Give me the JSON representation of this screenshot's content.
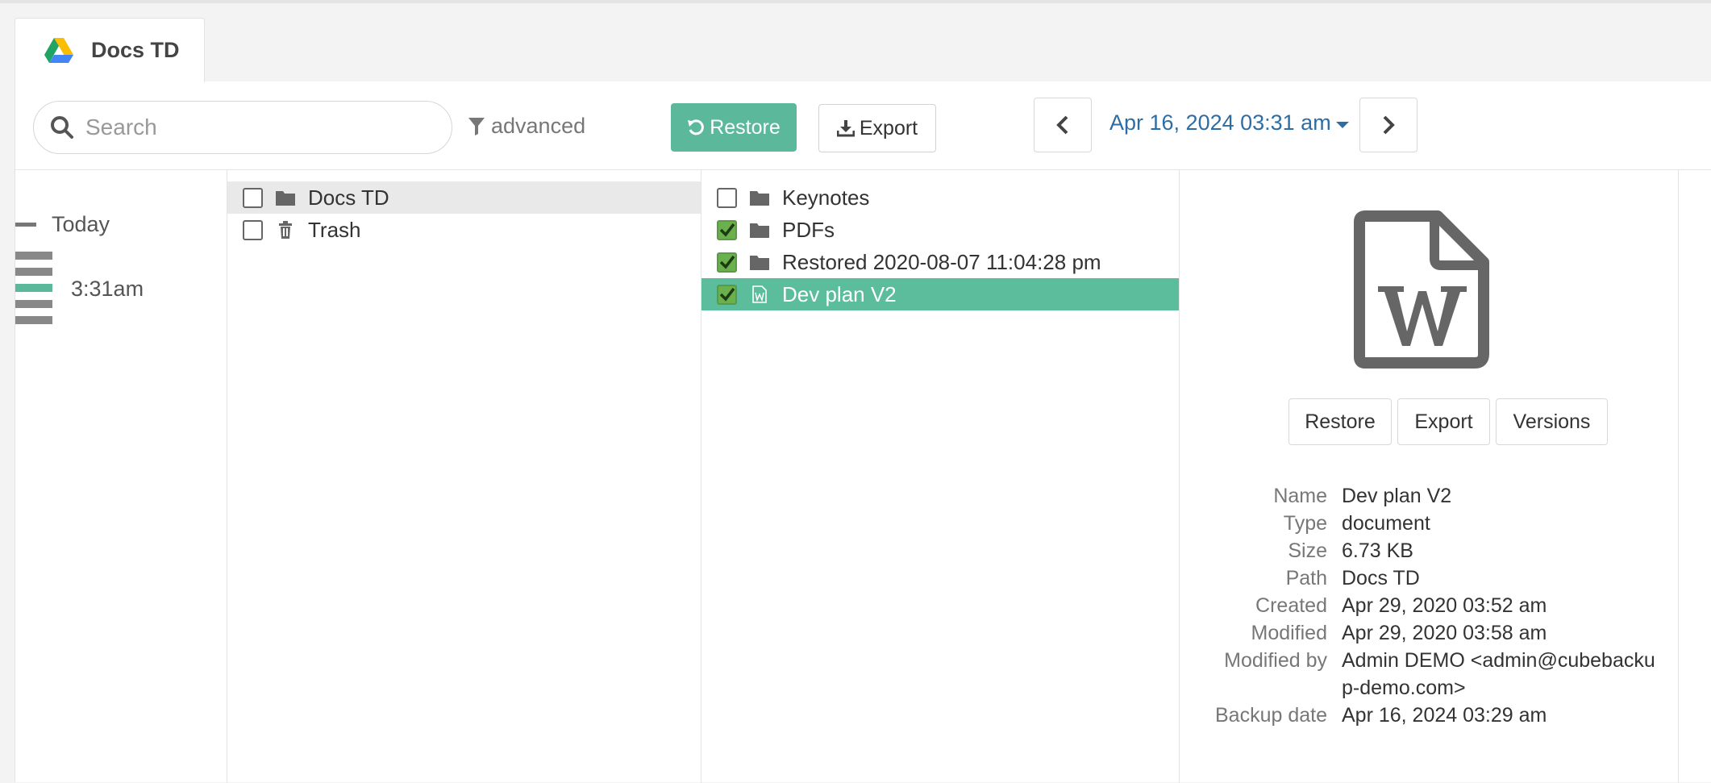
{
  "tab": {
    "label": "Docs TD",
    "logo_icon": "google-drive-icon"
  },
  "toolbar": {
    "search_placeholder": "Search",
    "advanced_label": "advanced",
    "restore_label": "Restore",
    "export_label": "Export",
    "date_label": "Apr 16, 2024 03:31 am"
  },
  "timeline": {
    "today_label": "Today",
    "time_label": "3:31am"
  },
  "tree": {
    "items": [
      {
        "label": "Docs TD",
        "icon": "folder-icon",
        "checked": false,
        "selected": true
      },
      {
        "label": "Trash",
        "icon": "trash-icon",
        "checked": false,
        "selected": false
      }
    ]
  },
  "files": {
    "items": [
      {
        "label": "Keynotes",
        "icon": "folder-icon",
        "checked": false
      },
      {
        "label": "PDFs",
        "icon": "folder-icon",
        "checked": true
      },
      {
        "label": "Restored 2020-08-07 11:04:28 pm",
        "icon": "folder-icon",
        "checked": true
      },
      {
        "label": "Dev plan V2",
        "icon": "word-document-icon",
        "checked": true,
        "highlighted": true
      }
    ]
  },
  "details": {
    "icon": "word-document-icon",
    "buttons": {
      "restore": "Restore",
      "export": "Export",
      "versions": "Versions"
    },
    "meta": [
      {
        "key": "Name",
        "value": "Dev plan V2"
      },
      {
        "key": "Type",
        "value": "document"
      },
      {
        "key": "Size",
        "value": "6.73 KB"
      },
      {
        "key": "Path",
        "value": "Docs TD"
      },
      {
        "key": "Created",
        "value": "Apr 29, 2020 03:52 am"
      },
      {
        "key": "Modified",
        "value": "Apr 29, 2020 03:58 am"
      },
      {
        "key": "Modified by",
        "value": "Admin DEMO <admin@cubebackup-demo.com>"
      },
      {
        "key": "Backup date",
        "value": "Apr 16, 2024 03:29 am"
      }
    ]
  },
  "colors": {
    "accent": "#5cb89a",
    "link": "#2e6da4",
    "check": "#6ab04c"
  }
}
